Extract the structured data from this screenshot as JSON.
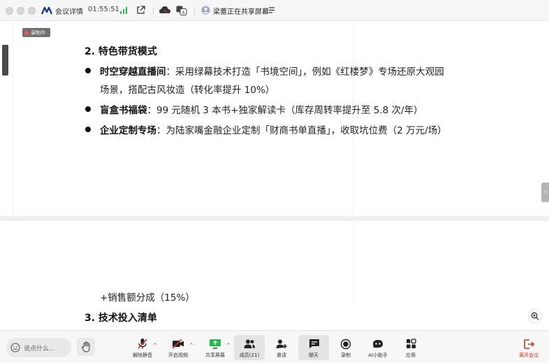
{
  "titlebar": {
    "meeting_details_label": "会议详情",
    "elapsed_time": "01:55:51",
    "sharing_status": "梁蕾正在共享屏幕"
  },
  "recording_badge": "录制中",
  "slide": {
    "section2_heading": "2. 特色带货模式",
    "bullets": [
      {
        "bold": "时空穿越直播间",
        "text": "：采用绿幕技术打造「书境空间」，例如《红楼梦》专场还原大观园",
        "continuation": "场景，搭配古风妆造（转化率提升 10%）"
      },
      {
        "bold": "盲盒书福袋",
        "text": "：99 元随机 3 本书+独家解读卡（库存周转率提升至 5.8 次/年）"
      },
      {
        "bold": "企业定制专场",
        "text": "：为陆家嘴金融企业定制「财商书单直播」，收取坑位费（2 万元/场）"
      }
    ],
    "revenue_share_line": "+销售额分成（15%）",
    "section3_heading": "3. 技术投入清单"
  },
  "toolbar": {
    "chat_placeholder": "说点什么...",
    "tools": [
      {
        "label": "解除静音",
        "icon": "mic-muted-icon"
      },
      {
        "label": "开启视频",
        "icon": "camera-off-icon"
      },
      {
        "label": "共享屏幕",
        "icon": "screen-share-icon"
      },
      {
        "label": "成员(21)",
        "icon": "members-icon"
      },
      {
        "label": "邀请",
        "icon": "invite-icon"
      },
      {
        "label": "聊天",
        "icon": "chat-icon"
      },
      {
        "label": "录制",
        "icon": "record-icon"
      },
      {
        "label": "AI小助手",
        "icon": "ai-assistant-icon"
      },
      {
        "label": "应用",
        "icon": "apps-icon"
      },
      {
        "label": "离开会议",
        "icon": "leave-icon"
      }
    ]
  },
  "colors": {
    "accent_green": "#1fbf4a",
    "danger_red": "#d9361f",
    "brand_blue": "#3a6ed8"
  }
}
